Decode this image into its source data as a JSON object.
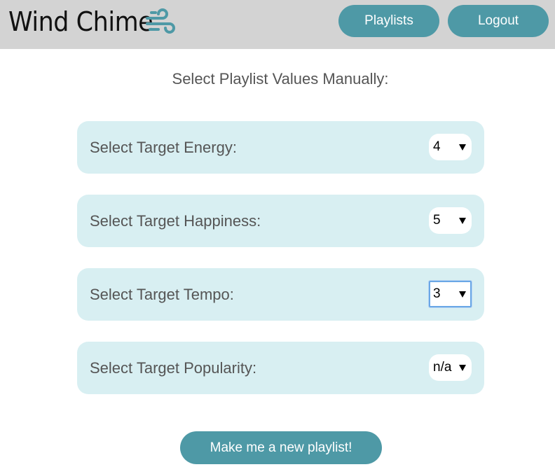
{
  "header": {
    "app_title": "Wind Chime",
    "logo_icon": "wind-icon",
    "playlists_label": "Playlists",
    "logout_label": "Logout"
  },
  "main": {
    "heading": "Select Playlist Values Manually:",
    "fields": [
      {
        "label": "Select Target Energy:",
        "value": "4"
      },
      {
        "label": "Select Target Happiness:",
        "value": "5"
      },
      {
        "label": "Select Target Tempo:",
        "value": "3",
        "focused": true
      },
      {
        "label": "Select Target Popularity:",
        "value": "n/a"
      }
    ],
    "submit_label": "Make me a new playlist!"
  },
  "colors": {
    "header_bg": "#d3d3d3",
    "accent": "#4e99a6",
    "row_bg": "#d8eff2",
    "focus_outline": "#6aa7e6"
  }
}
